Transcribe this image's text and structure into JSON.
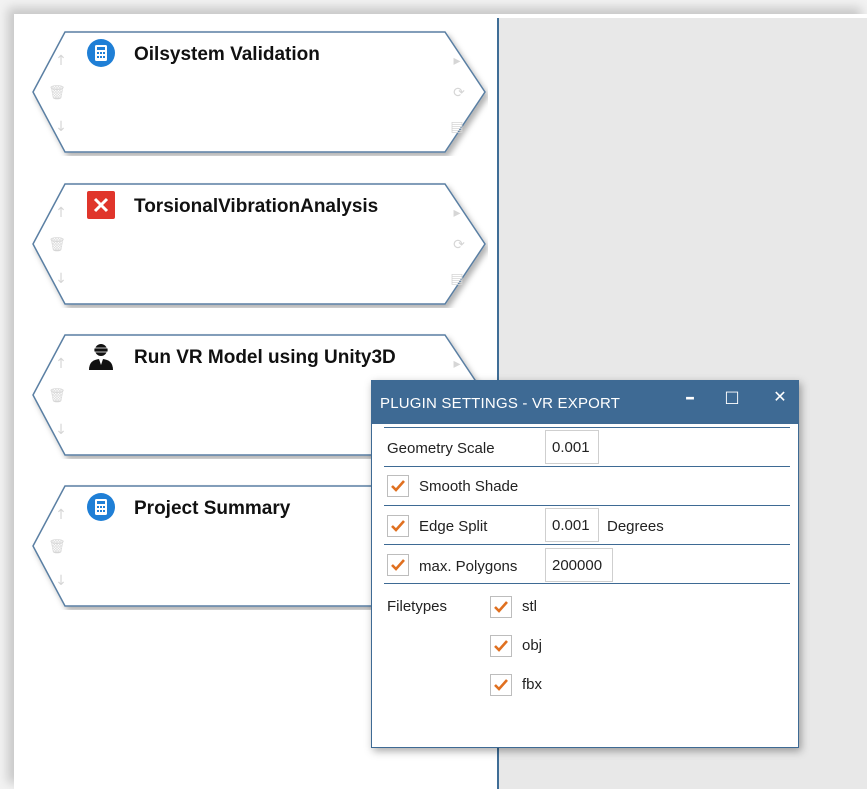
{
  "cards": [
    {
      "title": "Oilsystem Validation",
      "icon": "calculator-icon"
    },
    {
      "title": "TorsionalVibrationAnalysis",
      "icon": "torsional-x-icon"
    },
    {
      "title": "Run VR Model using Unity3D",
      "icon": "vr-user-icon"
    },
    {
      "title": "Project Summary",
      "icon": "calculator-icon"
    }
  ],
  "card_side_icons": {
    "up": "↑",
    "delete": "🗑",
    "down": "↓",
    "run": "▸",
    "refresh": "⟳",
    "save": "▤"
  },
  "dialog": {
    "title": "PLUGIN SETTINGS - VR EXPORT",
    "minimize": "–",
    "maximize": "□",
    "close": "✕",
    "geometry_scale": {
      "label": "Geometry Scale",
      "value": "0.001"
    },
    "smooth_shade": {
      "label": "Smooth Shade",
      "checked": true
    },
    "edge_split": {
      "label": "Edge Split",
      "value": "0.001",
      "unit": "Degrees",
      "checked": true
    },
    "max_polygons": {
      "label": "max. Polygons",
      "value": "200000",
      "checked": true
    },
    "filetypes": {
      "label": "Filetypes",
      "options": [
        {
          "label": "stl",
          "checked": true
        },
        {
          "label": "obj",
          "checked": true
        },
        {
          "label": "fbx",
          "checked": true
        }
      ]
    }
  },
  "colors": {
    "accent": "#3e6a94",
    "check": "#e07020",
    "card_border": "#5a7fa3"
  }
}
